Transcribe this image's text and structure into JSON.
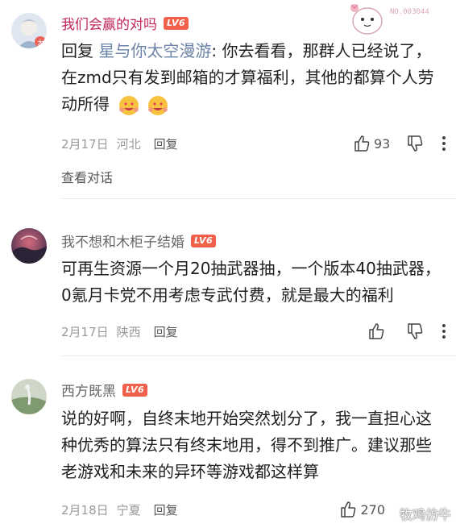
{
  "comments": [
    {
      "username": "我们会赢的对吗",
      "level": "LV6",
      "reply_prefix": "回复",
      "reply_target": "星与你太空漫游",
      "text": ": 你去看看，那群人已经说了，在zmd只有发到邮箱的才算福利，其他的都算个人劳动所得",
      "emoji": "grinning-hearts-emoji",
      "date": "2月17日",
      "location": "河北",
      "reply_label": "回复",
      "likes": "93",
      "view_thread": "查看对话"
    },
    {
      "username": "我不想和木柜子结婚",
      "level": "LV6",
      "text": "可再生资源一个月20抽武器抽，一个版本40抽武器，0氪月卡党不用考虑专武付费，就是最大的福利",
      "date": "2月17日",
      "location": "陕西",
      "reply_label": "回复",
      "likes": ""
    },
    {
      "username": "西方既黑",
      "level": "LV6",
      "text": "说的好啊，自终末地开始突然划分了，我一直担心这种优秀的算法只有终末地用，得不到推广。建议那些老游戏和未来的异环等游戏都这样算",
      "date": "2月18日",
      "location": "宁夏",
      "reply_label": "回复",
      "likes": "270"
    }
  ],
  "sticker_text": "NO.003044",
  "watermark": "牧鸡仿牛",
  "colors": {
    "username_highlight": "#c2255c",
    "level_badge": "#f0604a",
    "reply_target": "#6b83a8"
  }
}
